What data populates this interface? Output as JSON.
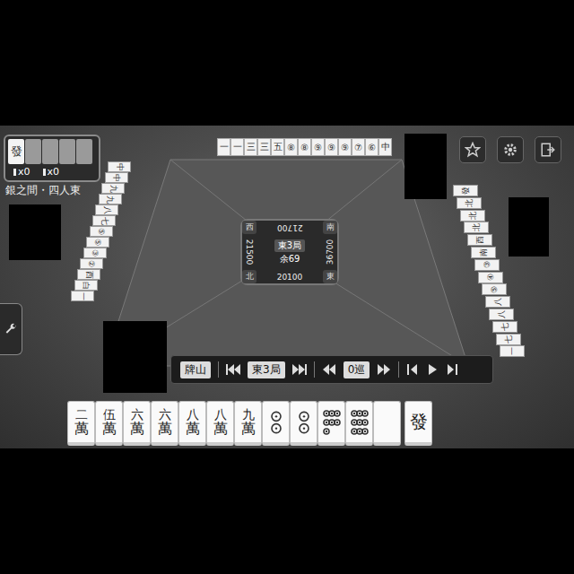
{
  "room": "銀之間・四人東",
  "dora": {
    "tiles": [
      {
        "revealed": true,
        "text": "發"
      },
      {
        "revealed": false
      },
      {
        "revealed": false
      },
      {
        "revealed": false
      },
      {
        "revealed": false
      }
    ],
    "counters": [
      "x0",
      "x0"
    ]
  },
  "center": {
    "round": "東3局",
    "remaining": "余69",
    "scores": [
      "21700",
      "21500",
      "36700",
      "20100"
    ],
    "winds": [
      "西",
      "南",
      "北",
      "東"
    ]
  },
  "controls": {
    "wall": "牌山",
    "round": "東3局",
    "turn": "0巡"
  },
  "opponents": {
    "top": [
      "一",
      "一",
      "三",
      "三",
      "五",
      "⑧",
      "⑧",
      "⑨",
      "⑨",
      "⑨",
      "⑦",
      "⑥",
      "中"
    ],
    "left": [
      "中",
      "中",
      "九",
      "九",
      "八",
      "七",
      "⑤",
      "⑤",
      "③",
      "②",
      "西",
      "白",
      "一"
    ],
    "right": [
      "發",
      "北",
      "北",
      "北",
      "西",
      "南",
      "③",
      "④",
      "⑤",
      "八",
      "八",
      "七",
      "七",
      "一"
    ]
  },
  "hand": [
    {
      "kind": "man",
      "rank": "二",
      "suit": "萬",
      "drawn": false
    },
    {
      "kind": "man",
      "rank": "伍",
      "suit": "萬",
      "drawn": false
    },
    {
      "kind": "man",
      "rank": "六",
      "suit": "萬",
      "drawn": false
    },
    {
      "kind": "man",
      "rank": "六",
      "suit": "萬",
      "drawn": false
    },
    {
      "kind": "man",
      "rank": "八",
      "suit": "萬",
      "drawn": false
    },
    {
      "kind": "man",
      "rank": "八",
      "suit": "萬",
      "drawn": false
    },
    {
      "kind": "man",
      "rank": "九",
      "suit": "萬",
      "drawn": false
    },
    {
      "kind": "pin",
      "dots": 2,
      "drawn": false
    },
    {
      "kind": "pin",
      "dots": 2,
      "drawn": false
    },
    {
      "kind": "pin",
      "dots": 7,
      "drawn": false
    },
    {
      "kind": "pin",
      "dots": 9,
      "drawn": false
    },
    {
      "kind": "blank",
      "drawn": false
    },
    {
      "kind": "honor",
      "text": "發",
      "drawn": true
    }
  ]
}
